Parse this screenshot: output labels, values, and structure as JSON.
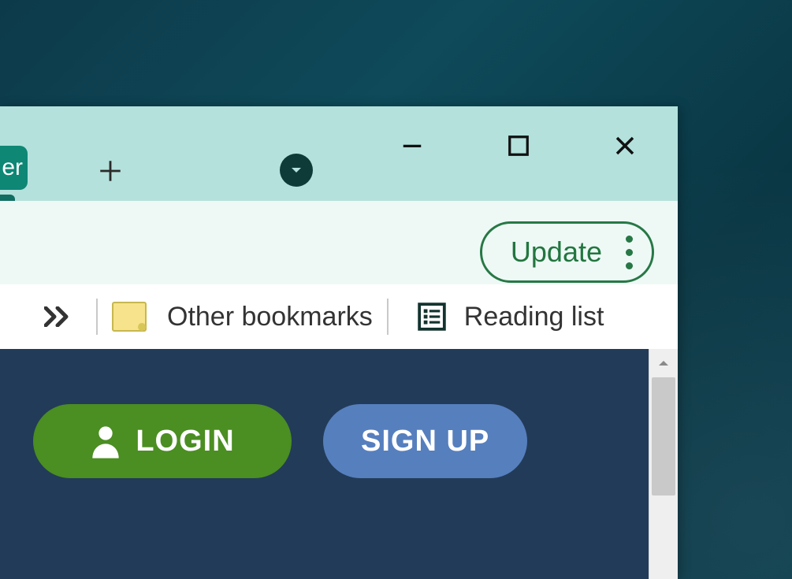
{
  "tabstrip": {
    "partial_tab_text": "er"
  },
  "toolbar": {
    "update_label": "Update"
  },
  "bookmarks": {
    "other_label": "Other bookmarks",
    "reading_label": "Reading list"
  },
  "page": {
    "login_label": "LOGIN",
    "signup_label": "SIGN UP"
  }
}
